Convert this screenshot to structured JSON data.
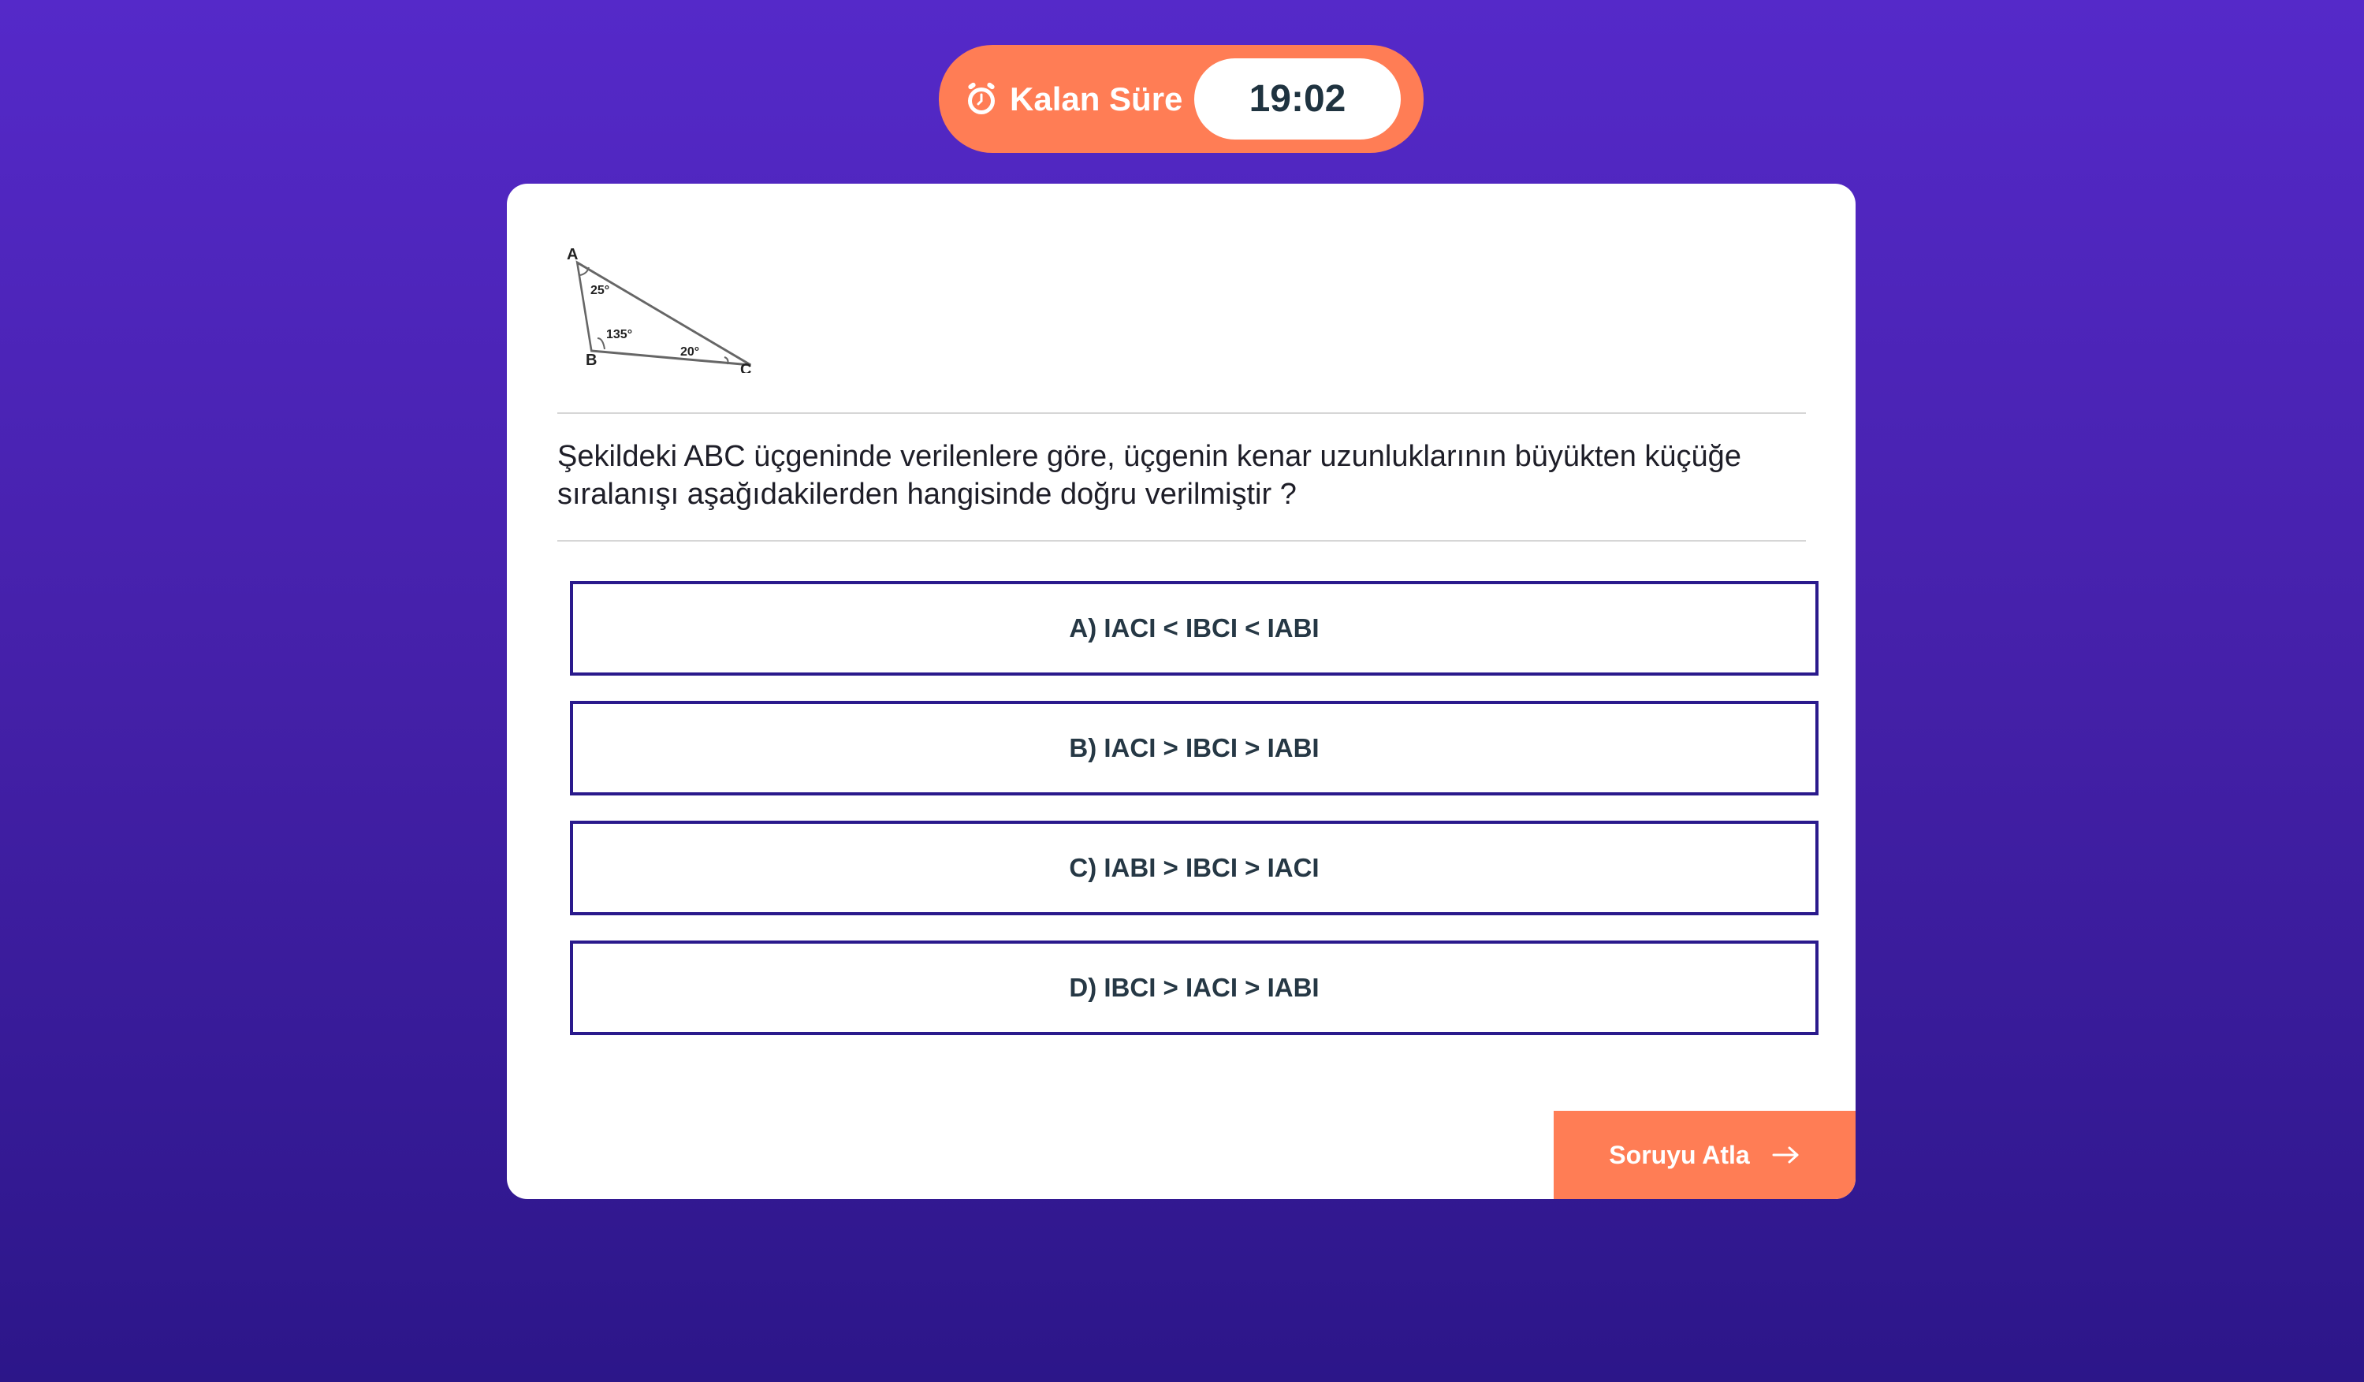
{
  "timer": {
    "icon": "alarm-clock-icon",
    "label": "Kalan Süre",
    "value": "19:02"
  },
  "question": {
    "figure": {
      "vertices": [
        "A",
        "B",
        "C"
      ],
      "angles": [
        "25°",
        "135°",
        "20°"
      ]
    },
    "text": "Şekildeki ABC üçgeninde verilenlere göre, üçgenin kenar uzunluklarının büyükten küçüğe sıralanışı aşağıdakilerden hangisinde doğru verilmiştir ?"
  },
  "options": [
    "A) IACI < IBCI < IABI",
    "B) IACI > IBCI > IABI",
    "C) IABI > IBCI > IACI",
    "D) IBCI > IACI > IABI"
  ],
  "skip": {
    "label": "Soruyu Atla",
    "icon": "arrow-right-icon"
  },
  "colors": {
    "accent": "#ff7d55",
    "border": "#2a1a8c",
    "background_top": "#5529c9",
    "background_bottom": "#2c1689"
  }
}
